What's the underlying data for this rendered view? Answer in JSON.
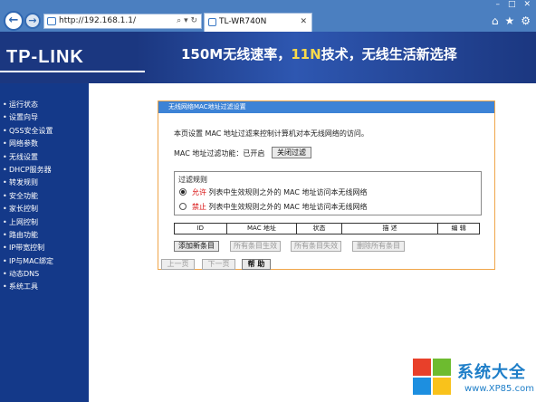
{
  "browser": {
    "address": "http://192.168.1.1/",
    "address_tools": "⌕ ▾ ↻",
    "tab_title": "TL-WR740N",
    "window_controls": [
      "–",
      "□",
      "✕"
    ]
  },
  "banner": {
    "logo": "TP-LINK",
    "slogan_part1": "150M无线速率，",
    "slogan_accent": "11N",
    "slogan_part2": "技术，无线生活新选择"
  },
  "sidebar": {
    "items": [
      "运行状态",
      "设置向导",
      "QSS安全设置",
      "网络参数",
      "无线设置",
      "DHCP服务器",
      "转发规则",
      "安全功能",
      "家长控制",
      "上网控制",
      "路由功能",
      "IP带宽控制",
      "IP与MAC绑定",
      "动态DNS",
      "系统工具"
    ]
  },
  "panel": {
    "title": "无线网络MAC地址过滤设置",
    "description": "本页设置 MAC 地址过滤来控制计算机对本无线网络的访问。",
    "status_label": "MAC 地址过滤功能：已开启",
    "close_filter_button": "关闭过滤",
    "rules_legend": "过滤规则",
    "rule_allow_keyword": "允许",
    "rule_allow_text": " 列表中生效规则之外的 MAC 地址访问本无线网络",
    "rule_deny_keyword": "禁止",
    "rule_deny_text": " 列表中生效规则之外的 MAC 地址访问本无线网络",
    "selected_rule": "allow",
    "table_headers": [
      "ID",
      "MAC 地址",
      "状态",
      "描 述",
      "编 辑"
    ],
    "buttons": {
      "add": "添加新条目",
      "enable_all": "所有条目生效",
      "disable_all": "所有条目失效",
      "delete_all": "删除所有条目",
      "prev": "上一页",
      "next": "下一页",
      "help": "帮 助"
    }
  },
  "watermark": {
    "title": "系统大全",
    "url": "www.XP85.com"
  },
  "colors": {
    "banner": "#1b3780",
    "sidebar": "#143989",
    "panel_header": "#3d83d6",
    "panel_border": "#f0a64a",
    "accent_red": "#d81010"
  }
}
